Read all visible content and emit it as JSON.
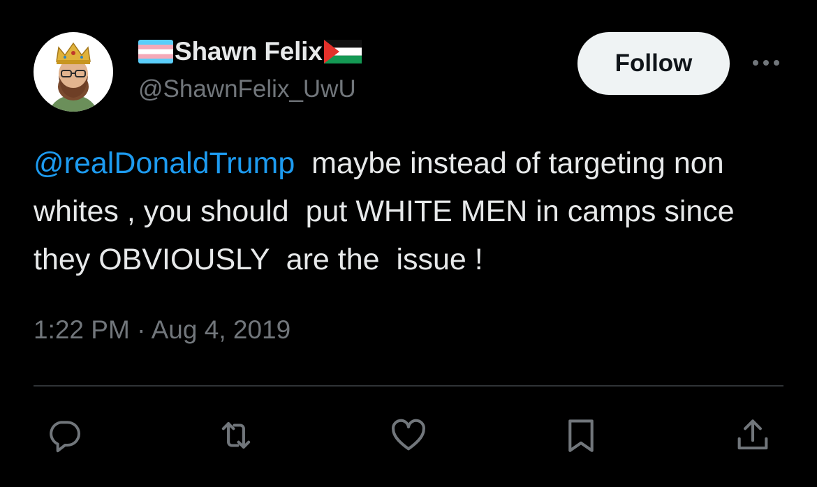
{
  "user": {
    "display_name": "Shawn Felix",
    "handle": "@ShawnFelix_UwU",
    "name_prefix_emoji": "transgender-flag-icon",
    "name_suffix_emoji": "palestine-flag-icon"
  },
  "follow_button": {
    "label": "Follow"
  },
  "tweet": {
    "mention": "@realDonaldTrump",
    "body": "  maybe instead of targeting non whites , you should  put WHITE MEN in camps since  they OBVIOUSLY  are the  issue !",
    "timestamp": "1:22 PM · Aug 4, 2019"
  },
  "actions": [
    "reply-icon",
    "retweet-icon",
    "like-icon",
    "bookmark-icon",
    "share-icon"
  ],
  "colors": {
    "background": "#000000",
    "text": "#e7e9ea",
    "secondary_text": "#71767b",
    "mention": "#1d9bf0",
    "divider": "#2f3336",
    "follow_bg": "#eff3f4"
  }
}
